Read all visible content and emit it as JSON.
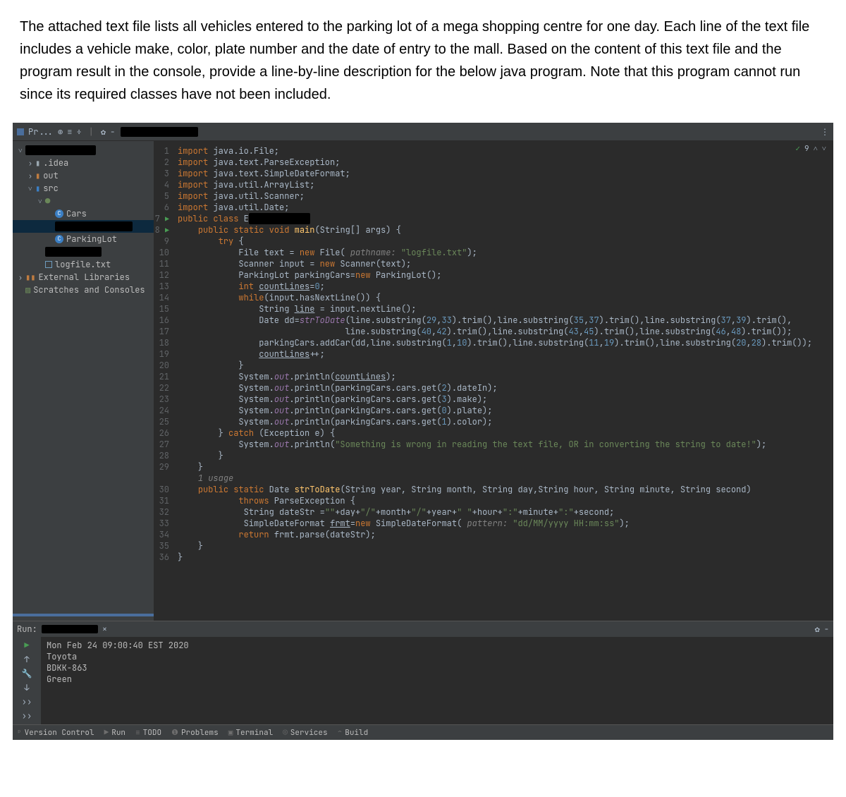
{
  "question": "The attached text file lists all vehicles entered to the parking lot of a mega shopping centre for one day. Each line of the text file includes a vehicle make, color, plate number and the date of entry to the mall. Based on the content of this text file and the program result in the console, provide a line-by-line description for the below java program. Note that this program cannot run since its required classes have not been included.",
  "toolbar": {
    "project_label": "Pr...",
    "icons": {
      "target": "⊕",
      "collapse": "≡",
      "split": "÷",
      "gear": "✿",
      "dash": "−",
      "more": "⋮"
    }
  },
  "tree": {
    "items": [
      {
        "indent": 0,
        "caret": "˅",
        "icon": "black",
        "label": "",
        "black_w": 100
      },
      {
        "indent": 1,
        "caret": "›",
        "icon": "folder-grey",
        "label": ".idea"
      },
      {
        "indent": 1,
        "caret": "›",
        "icon": "folder-orange",
        "label": "out"
      },
      {
        "indent": 1,
        "caret": "˅",
        "icon": "folder-blue",
        "label": "src"
      },
      {
        "indent": 2,
        "caret": "˅",
        "icon": "pkg",
        "label": "",
        "black_w": 90
      },
      {
        "indent": 3,
        "caret": "",
        "icon": "class",
        "label": "Cars"
      },
      {
        "indent": 3,
        "caret": "",
        "icon": "black",
        "label": "",
        "black_w": 110,
        "sel": true
      },
      {
        "indent": 3,
        "caret": "",
        "icon": "class",
        "label": "ParkingLot"
      },
      {
        "indent": 2,
        "caret": "",
        "icon": "black",
        "label": "",
        "black_w": 80
      },
      {
        "indent": 2,
        "caret": "",
        "icon": "file",
        "label": "logfile.txt"
      },
      {
        "indent": 0,
        "caret": "›",
        "icon": "lib",
        "label": "External Libraries"
      },
      {
        "indent": 0,
        "caret": "",
        "icon": "scratch",
        "label": "Scratches and Consoles"
      }
    ]
  },
  "editor": {
    "top_right": {
      "check": "✓",
      "warn": "9",
      "up": "˄",
      "down": "˅"
    },
    "usage_hint": "1 usage",
    "code": [
      {
        "n": 1,
        "arrow": false,
        "html": "<span class='k'>import</span> java.io.File;"
      },
      {
        "n": 2,
        "arrow": false,
        "html": "<span class='k'>import</span> java.text.ParseException;"
      },
      {
        "n": 3,
        "arrow": false,
        "html": "<span class='k'>import</span> java.text.SimpleDateFormat;"
      },
      {
        "n": 4,
        "arrow": false,
        "html": "<span class='k'>import</span> java.util.ArrayList;"
      },
      {
        "n": 5,
        "arrow": false,
        "html": "<span class='k'>import</span> java.util.Scanner;"
      },
      {
        "n": 6,
        "arrow": false,
        "html": "<span class='k'>import</span> java.util.Date;"
      },
      {
        "n": 7,
        "arrow": true,
        "html": "<span class='k'>public class</span> E<span style='background:#000;padding:0 40px;border-radius:2px'>&nbsp;</span>"
      },
      {
        "n": 8,
        "arrow": true,
        "html": "    <span class='k'>public static void</span> <span class='f'>main</span>(String[] args) {"
      },
      {
        "n": 9,
        "arrow": false,
        "html": "        <span class='k'>try</span> {"
      },
      {
        "n": 10,
        "arrow": false,
        "html": "            File text = <span class='k'>new</span> File(<span class='c'> pathname: </span><span class='s'>\"logfile.txt\"</span>);"
      },
      {
        "n": 11,
        "arrow": false,
        "html": "            Scanner input = <span class='k'>new</span> Scanner(text);"
      },
      {
        "n": 12,
        "arrow": false,
        "html": "            ParkingLot parkingCars=<span class='k'>new</span> ParkingLot();"
      },
      {
        "n": 13,
        "arrow": false,
        "html": "            <span class='k'>int</span> <span class='u'>countLines</span>=<span class='n'>0</span>;"
      },
      {
        "n": 14,
        "arrow": false,
        "html": "            <span class='k'>while</span>(input.hasNextLine()) {"
      },
      {
        "n": 15,
        "arrow": false,
        "html": "                String <span class='u'>line</span> = input.nextLine();"
      },
      {
        "n": 16,
        "arrow": false,
        "html": "                Date dd=<span class='m'>strToDate</span>(line.substring(<span class='n'>29</span>,<span class='n'>33</span>).trim(),line.substring(<span class='n'>35</span>,<span class='n'>37</span>).trim(),line.substring(<span class='n'>37</span>,<span class='n'>39</span>).trim(),"
      },
      {
        "n": 17,
        "arrow": false,
        "html": "                                 line.substring(<span class='n'>40</span>,<span class='n'>42</span>).trim(),line.substring(<span class='n'>43</span>,<span class='n'>45</span>).trim(),line.substring(<span class='n'>46</span>,<span class='n'>48</span>).trim());"
      },
      {
        "n": 18,
        "arrow": false,
        "html": "                parkingCars.addCar(dd,line.substring(<span class='n'>1</span>,<span class='n'>10</span>).trim(),line.substring(<span class='n'>11</span>,<span class='n'>19</span>).trim(),line.substring(<span class='n'>20</span>,<span class='n'>28</span>).trim());"
      },
      {
        "n": 19,
        "arrow": false,
        "html": "                <span class='u'>countLines</span>++;"
      },
      {
        "n": 20,
        "arrow": false,
        "html": "            }"
      },
      {
        "n": 21,
        "arrow": false,
        "html": "            System.<span class='m'>out</span>.println(<span class='u'>countLines</span>);"
      },
      {
        "n": 22,
        "arrow": false,
        "html": "            System.<span class='m'>out</span>.println(parkingCars.cars.get(<span class='n'>2</span>).dateIn);"
      },
      {
        "n": 23,
        "arrow": false,
        "html": "            System.<span class='m'>out</span>.println(parkingCars.cars.get(<span class='n'>3</span>).make);"
      },
      {
        "n": 24,
        "arrow": false,
        "html": "            System.<span class='m'>out</span>.println(parkingCars.cars.get(<span class='n'>0</span>).plate);"
      },
      {
        "n": 25,
        "arrow": false,
        "html": "            System.<span class='m'>out</span>.println(parkingCars.cars.get(<span class='n'>1</span>).color);"
      },
      {
        "n": 26,
        "arrow": false,
        "html": "        } <span class='k'>catch</span> (Exception e) {"
      },
      {
        "n": 27,
        "arrow": false,
        "html": "            System.<span class='m'>out</span>.println(<span class='s'>\"Something is wrong in reading the text file, OR in converting the string to date!\"</span>);"
      },
      {
        "n": 28,
        "arrow": false,
        "html": "        }"
      },
      {
        "n": 29,
        "arrow": false,
        "html": "    }"
      },
      {
        "n": "",
        "arrow": false,
        "html": "    <span class='c'>1 usage</span>"
      },
      {
        "n": 30,
        "arrow": false,
        "html": "    <span class='k'>public static</span> Date <span class='f'>strToDate</span>(String year, String month, String day,String hour, String minute, String second)"
      },
      {
        "n": 31,
        "arrow": false,
        "html": "            <span class='k'>throws</span> ParseException {"
      },
      {
        "n": 32,
        "arrow": false,
        "html": "             String dateStr =<span class='s'>\"\"</span>+day+<span class='s'>\"/\"</span>+month+<span class='s'>\"/\"</span>+year+<span class='s'>\" \"</span>+hour+<span class='s'>\":\"</span>+minute+<span class='s'>\":\"</span>+second;"
      },
      {
        "n": 33,
        "arrow": false,
        "html": "             SimpleDateFormat <span class='u'>frmt</span>=<span class='k'>new</span> SimpleDateFormat(<span class='c'> pattern: </span><span class='s'>\"dd/MM/yyyy HH:mm:ss\"</span>);"
      },
      {
        "n": 34,
        "arrow": false,
        "html": "            <span class='k'>return</span> frmt.parse(dateStr);"
      },
      {
        "n": 35,
        "arrow": false,
        "html": "    }"
      },
      {
        "n": 36,
        "arrow": false,
        "html": "}"
      }
    ]
  },
  "run": {
    "label": "Run:",
    "ctrl": {
      "play": "▶",
      "up": "↑",
      "wrench": "🔧",
      "down": "↓",
      "more1": "››",
      "more2": "››"
    },
    "output": [
      "Mon Feb 24 09:00:40 EST 2020",
      "Toyota",
      "BDKK-863",
      "Green"
    ],
    "gear": "✿",
    "dash": "−"
  },
  "bottom": {
    "items": [
      {
        "icon": "ᵖ",
        "label": "Version Control"
      },
      {
        "icon": "▶",
        "label": "Run",
        "play": true
      },
      {
        "icon": "≡",
        "label": "TODO"
      },
      {
        "icon": "❶",
        "label": "Problems"
      },
      {
        "icon": "▣",
        "label": "Terminal"
      },
      {
        "icon": "◎",
        "label": "Services"
      },
      {
        "icon": "⌃",
        "label": "Build"
      }
    ]
  }
}
